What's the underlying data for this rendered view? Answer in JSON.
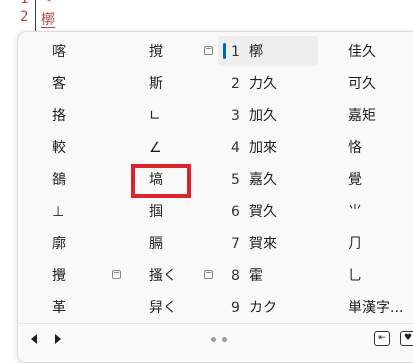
{
  "editor": {
    "line1_number": "1",
    "line1_text": "<",
    "line2_number": "2",
    "line2_text": "槨"
  },
  "candidates": {
    "col1": [
      {
        "text": "喀",
        "copy_icon": false
      },
      {
        "text": "客",
        "copy_icon": false
      },
      {
        "text": "挌",
        "copy_icon": false
      },
      {
        "text": "較",
        "copy_icon": false
      },
      {
        "text": "鵅",
        "copy_icon": false
      },
      {
        "text": "⊥",
        "copy_icon": false
      },
      {
        "text": "廓",
        "copy_icon": false
      },
      {
        "text": "攪",
        "copy_icon": true
      },
      {
        "text": "革",
        "copy_icon": false
      }
    ],
    "col2": [
      {
        "text": "撹",
        "copy_icon": true
      },
      {
        "text": "斯",
        "copy_icon": false
      },
      {
        "text": "∟",
        "copy_icon": false
      },
      {
        "text": "∠",
        "copy_icon": false
      },
      {
        "text": "塙",
        "copy_icon": false
      },
      {
        "text": "掴",
        "copy_icon": false
      },
      {
        "text": "膈",
        "copy_icon": false
      },
      {
        "text": "搔く",
        "copy_icon": true
      },
      {
        "text": "舁く",
        "copy_icon": false
      }
    ],
    "col3": [
      {
        "num": "1",
        "text": "槨"
      },
      {
        "num": "2",
        "text": "力久"
      },
      {
        "num": "3",
        "text": "加久"
      },
      {
        "num": "4",
        "text": "加來"
      },
      {
        "num": "5",
        "text": "嘉久"
      },
      {
        "num": "6",
        "text": "賀久"
      },
      {
        "num": "7",
        "text": "賀來"
      },
      {
        "num": "8",
        "text": "霍"
      },
      {
        "num": "9",
        "text": "カク"
      }
    ],
    "col4": [
      {
        "text": "佳久"
      },
      {
        "text": "可久"
      },
      {
        "text": "嘉矩"
      },
      {
        "text": "恪"
      },
      {
        "text": "覺"
      },
      {
        "text": "⺌"
      },
      {
        "text": "⺆"
      },
      {
        "text": "⺃"
      },
      {
        "text": "単漢字..."
      }
    ],
    "selected_index": 0,
    "highlighted": "∠"
  },
  "footer": {
    "prev_icon": "triangle-left-icon",
    "next_icon": "triangle-right-icon",
    "page_dots": 2,
    "btn1_icon": "expand-panel-icon",
    "btn1_glyph": "⇤",
    "btn2_icon": "heart-icon",
    "btn2_glyph": "♥"
  },
  "colors": {
    "accent": "#0067c0",
    "highlight_box": "#d9252b",
    "line_number": "#b04a4a"
  }
}
